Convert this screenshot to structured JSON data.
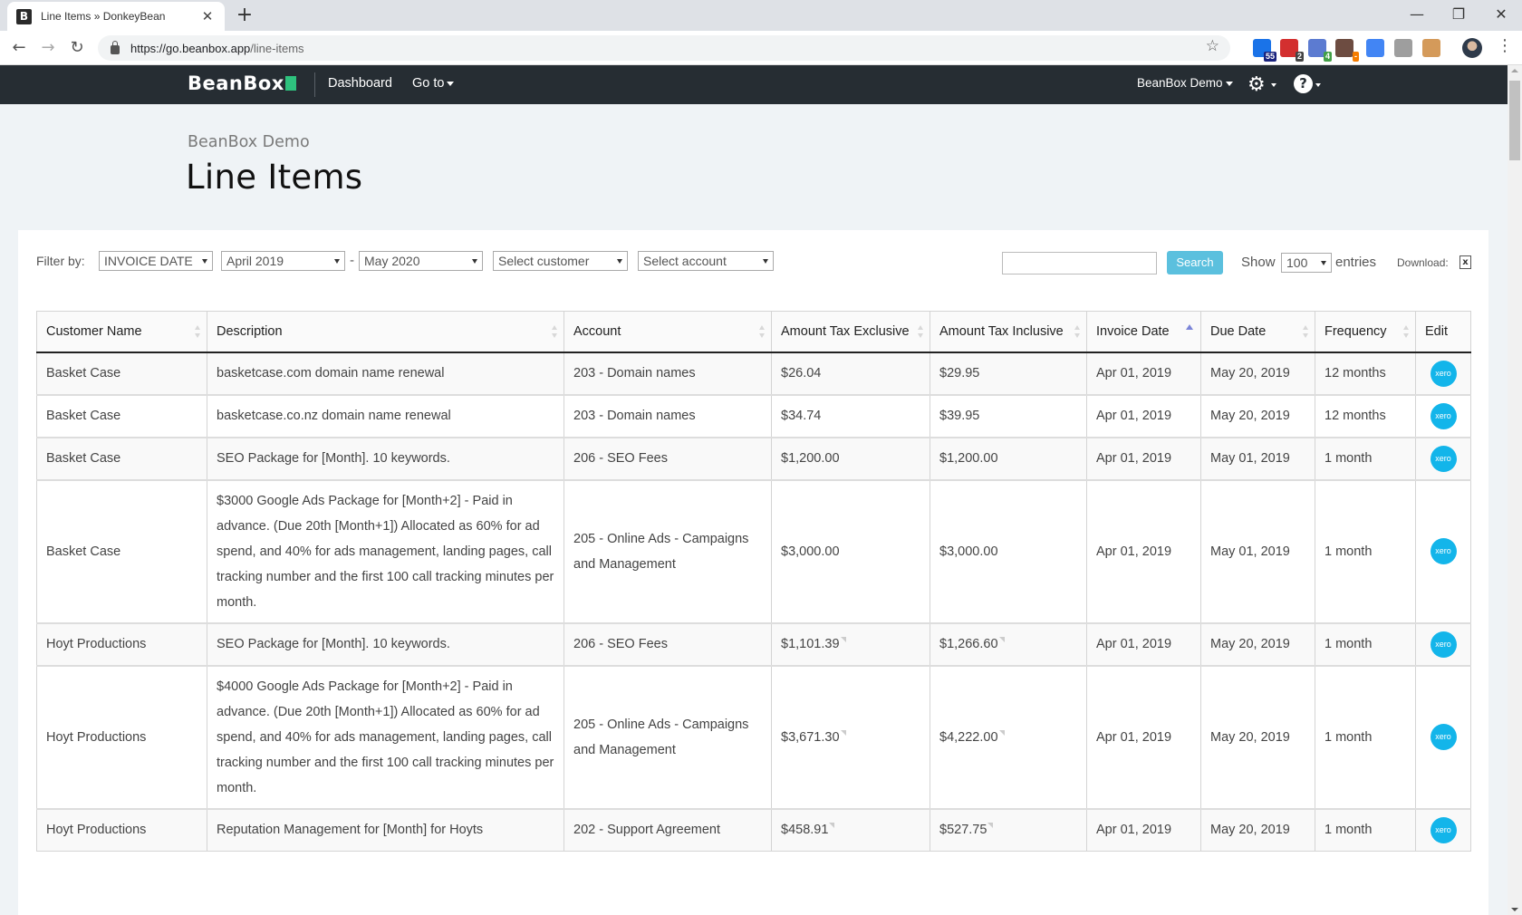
{
  "browser": {
    "tab_title": "Line Items » DonkeyBean",
    "favicon_letter": "B",
    "url_host": "https://go.beanbox.app",
    "url_path": "/line-items",
    "extensions": [
      {
        "name": "ext-1",
        "badge": "55",
        "color": "#1a73e8",
        "badge_color": "#1a237e"
      },
      {
        "name": "ext-2",
        "badge": "2",
        "color": "#d32f2f",
        "badge_color": "#444"
      },
      {
        "name": "ext-3",
        "badge": "4",
        "color": "#5c7bd1",
        "badge_color": "#43a047"
      },
      {
        "name": "ext-4",
        "badge": "-",
        "color": "#6d4c41",
        "badge_color": "#f57c00"
      },
      {
        "name": "ext-5",
        "badge": "",
        "color": "#4285f4",
        "badge_color": ""
      },
      {
        "name": "ext-6",
        "badge": "",
        "color": "#9e9e9e",
        "badge_color": ""
      },
      {
        "name": "ext-7",
        "badge": "",
        "color": "#d49a5a",
        "badge_color": ""
      }
    ]
  },
  "nav": {
    "brand": "BeanBox",
    "links": [
      "Dashboard",
      "Go to"
    ],
    "org_menu": "BeanBox Demo"
  },
  "page": {
    "org_name": "BeanBox Demo",
    "title": "Line Items"
  },
  "filters": {
    "label": "Filter by:",
    "filter_type": "INVOICE DATE",
    "date_from": "April 2019",
    "date_separator": "-",
    "date_to": "May 2020",
    "customer_placeholder": "Select customer",
    "account_placeholder": "Select account",
    "search_value": "",
    "search_button": "Search",
    "show_label": "Show",
    "page_size": "100",
    "entries_label": "entries",
    "download_label": "Download:",
    "download_icon": "excel-file-icon"
  },
  "table": {
    "columns": [
      "Customer Name",
      "Description",
      "Account",
      "Amount Tax Exclusive",
      "Amount Tax Inclusive",
      "Invoice Date",
      "Due Date",
      "Frequency",
      "Edit"
    ],
    "sorted_column": "Invoice Date",
    "sort_direction": "asc",
    "edit_icon_label": "xero",
    "rows": [
      {
        "customer": "Basket Case",
        "description": "basketcase.com domain name renewal",
        "account": "203 - Domain names",
        "amount_ex": "$26.04",
        "amount_inc": "$29.95",
        "invoice_date": "Apr 01, 2019",
        "due_date": "May 20, 2019",
        "frequency": "12 months",
        "note": false
      },
      {
        "customer": "Basket Case",
        "description": "basketcase.co.nz domain name renewal",
        "account": "203 - Domain names",
        "amount_ex": "$34.74",
        "amount_inc": "$39.95",
        "invoice_date": "Apr 01, 2019",
        "due_date": "May 20, 2019",
        "frequency": "12 months",
        "note": false
      },
      {
        "customer": "Basket Case",
        "description": "SEO Package for [Month]. 10 keywords.",
        "account": "206 - SEO Fees",
        "amount_ex": "$1,200.00",
        "amount_inc": "$1,200.00",
        "invoice_date": "Apr 01, 2019",
        "due_date": "May 01, 2019",
        "frequency": "1 month",
        "note": false
      },
      {
        "customer": "Basket Case",
        "description": "$3000 Google Ads Package for [Month+2] - Paid in advance. (Due 20th [Month+1]) Allocated as 60% for ad spend, and 40% for ads management, landing pages, call tracking number and the first 100 call tracking minutes per month.",
        "account": "205 - Online Ads - Campaigns and Management",
        "amount_ex": "$3,000.00",
        "amount_inc": "$3,000.00",
        "invoice_date": "Apr 01, 2019",
        "due_date": "May 01, 2019",
        "frequency": "1 month",
        "note": false
      },
      {
        "customer": "Hoyt Productions",
        "description": "SEO Package for [Month]. 10 keywords.",
        "account": "206 - SEO Fees",
        "amount_ex": "$1,101.39",
        "amount_inc": "$1,266.60",
        "invoice_date": "Apr 01, 2019",
        "due_date": "May 20, 2019",
        "frequency": "1 month",
        "note": true
      },
      {
        "customer": "Hoyt Productions",
        "description": "$4000 Google Ads Package for [Month+2] - Paid in advance. (Due 20th [Month+1]) Allocated as 60% for ad spend, and 40% for ads management, landing pages, call tracking number and the first 100 call tracking minutes per month.",
        "account": "205 - Online Ads - Campaigns and Management",
        "amount_ex": "$3,671.30",
        "amount_inc": "$4,222.00",
        "invoice_date": "Apr 01, 2019",
        "due_date": "May 20, 2019",
        "frequency": "1 month",
        "note": true
      },
      {
        "customer": "Hoyt Productions",
        "description": "Reputation Management for [Month] for Hoyts",
        "account": "202 - Support Agreement",
        "amount_ex": "$458.91",
        "amount_inc": "$527.75",
        "invoice_date": "Apr 01, 2019",
        "due_date": "May 20, 2019",
        "frequency": "1 month",
        "note": true
      }
    ]
  },
  "colors": {
    "navbar": "#262d33",
    "brand_accent": "#2ec27e",
    "search_button": "#5bc0de",
    "xero": "#13b5ea",
    "sort_active": "#7b85d8"
  }
}
